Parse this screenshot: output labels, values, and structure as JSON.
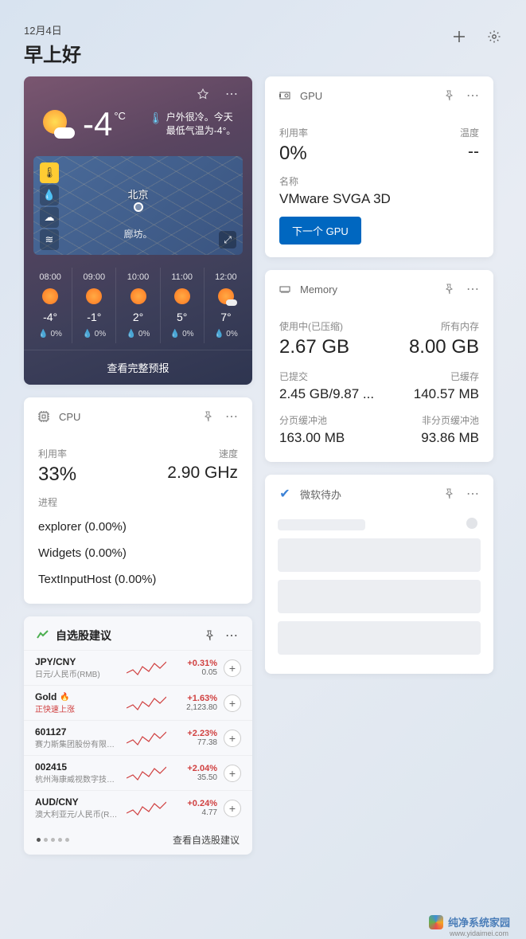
{
  "header": {
    "date": "12月4日",
    "greeting": "早上好"
  },
  "weather": {
    "temp": "-4",
    "unit": "°C",
    "desc": "户外很冷。今天最低气温为-4°。",
    "mapCity1": "北京",
    "mapCity2": "廊坊。",
    "hourly": [
      {
        "time": "08:00",
        "temp": "-4°",
        "rain": "0%",
        "cloudy": false
      },
      {
        "time": "09:00",
        "temp": "-1°",
        "rain": "0%",
        "cloudy": false
      },
      {
        "time": "10:00",
        "temp": "2°",
        "rain": "0%",
        "cloudy": false
      },
      {
        "time": "11:00",
        "temp": "5°",
        "rain": "0%",
        "cloudy": false
      },
      {
        "time": "12:00",
        "temp": "7°",
        "rain": "0%",
        "cloudy": true
      }
    ],
    "footer": "查看完整预报"
  },
  "cpu": {
    "title": "CPU",
    "utilLabel": "利用率",
    "speedLabel": "速度",
    "util": "33%",
    "speed": "2.90 GHz",
    "procLabel": "进程",
    "procs": [
      "explorer (0.00%)",
      "Widgets (0.00%)",
      "TextInputHost (0.00%)"
    ]
  },
  "gpu": {
    "title": "GPU",
    "utilLabel": "利用率",
    "tempLabel": "温度",
    "util": "0%",
    "temp": "--",
    "nameLabel": "名称",
    "name": "VMware SVGA 3D",
    "button": "下一个 GPU"
  },
  "memory": {
    "title": "Memory",
    "usedLabel": "使用中(已压缩)",
    "totalLabel": "所有内存",
    "used": "2.67 GB",
    "total": "8.00 GB",
    "commitLabel": "已提交",
    "cachedLabel": "已缓存",
    "commit": "2.45 GB/9.87 ...",
    "cached": "140.57 MB",
    "pagedLabel": "分页缓冲池",
    "nonpagedLabel": "非分页缓冲池",
    "paged": "163.00 MB",
    "nonpaged": "93.86 MB"
  },
  "todo": {
    "title": "微软待办"
  },
  "stocks": {
    "title": "自选股建议",
    "rows": [
      {
        "sym": "JPY/CNY",
        "sub": "日元/人民币(RMB)",
        "change": "+0.31%",
        "price": "0.05",
        "rising": false,
        "fire": false
      },
      {
        "sym": "Gold",
        "sub": "正快速上涨",
        "change": "+1.63%",
        "price": "2,123.80",
        "rising": true,
        "fire": true
      },
      {
        "sym": "601127",
        "sub": "赛力斯集团股份有限公司",
        "change": "+2.23%",
        "price": "77.38",
        "rising": false,
        "fire": false
      },
      {
        "sym": "002415",
        "sub": "杭州海康威视数字技术股份…",
        "change": "+2.04%",
        "price": "35.50",
        "rising": false,
        "fire": false
      },
      {
        "sym": "AUD/CNY",
        "sub": "澳大利亚元/人民币(RMB)",
        "change": "+0.24%",
        "price": "4.77",
        "rising": false,
        "fire": false
      }
    ],
    "footer": "查看自选股建议"
  },
  "watermark": {
    "text": "纯净系统家园",
    "url": "www.yidaimei.com"
  }
}
